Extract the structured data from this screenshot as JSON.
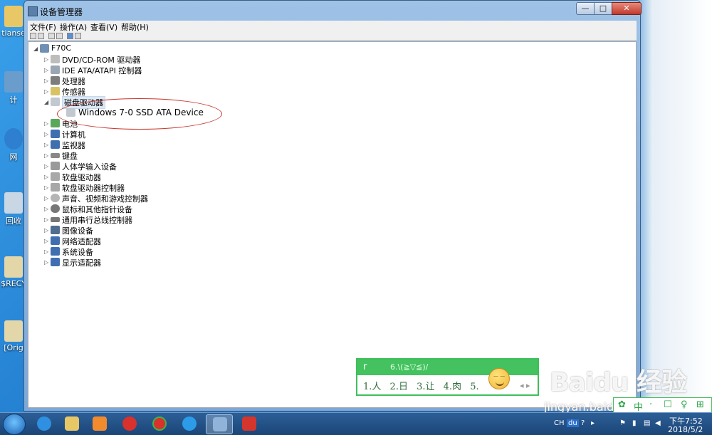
{
  "window": {
    "title": "设备管理器",
    "min_glyph": "—",
    "max_glyph": "□",
    "close_glyph": "✕"
  },
  "menubar": {
    "file": "文件(F)",
    "action": "操作(A)",
    "view": "查看(V)",
    "help": "帮助(H)"
  },
  "tree": {
    "root": "F70C",
    "items": [
      "DVD/CD-ROM 驱动器",
      "IDE ATA/ATAPI 控制器",
      "处理器",
      "传感器",
      "磁盘驱动器",
      "Windows 7-0 SSD ATA Device",
      "电池",
      "计算机",
      "监视器",
      "键盘",
      "人体学输入设备",
      "软盘驱动器",
      "软盘驱动器控制器",
      "声音、视频和游戏控制器",
      "鼠标和其他指针设备",
      "通用串行总线控制器",
      "图像设备",
      "网络适配器",
      "系统设备",
      "显示适配器"
    ]
  },
  "desktop_icons": [
    {
      "label": "tianse"
    },
    {
      "label": "计"
    },
    {
      "label": "网"
    },
    {
      "label": "回收"
    },
    {
      "label": "$RECY"
    },
    {
      "label": "[Orig"
    }
  ],
  "ime": {
    "input": "r",
    "hint": "6.\\(≧▽≦)/",
    "candidates": [
      "1.人",
      "2.日",
      "3.让",
      "4.肉",
      "5."
    ],
    "arrows": "◂ ▸"
  },
  "watermark": {
    "logo": "Baidu 经验",
    "url": "jingyan.baidu.com"
  },
  "ime_status": {
    "items": [
      "中",
      "·",
      "♀",
      "⊞"
    ]
  },
  "taskbar": {
    "tray_lang": "CH",
    "tray_du": "du",
    "clock_time": "下午7:52",
    "clock_date": "2018/5/2"
  },
  "colors": {
    "annotation_ellipse": "#c8342c",
    "ime_green": "#43c25f",
    "window_frame": "#9ec1e6"
  }
}
